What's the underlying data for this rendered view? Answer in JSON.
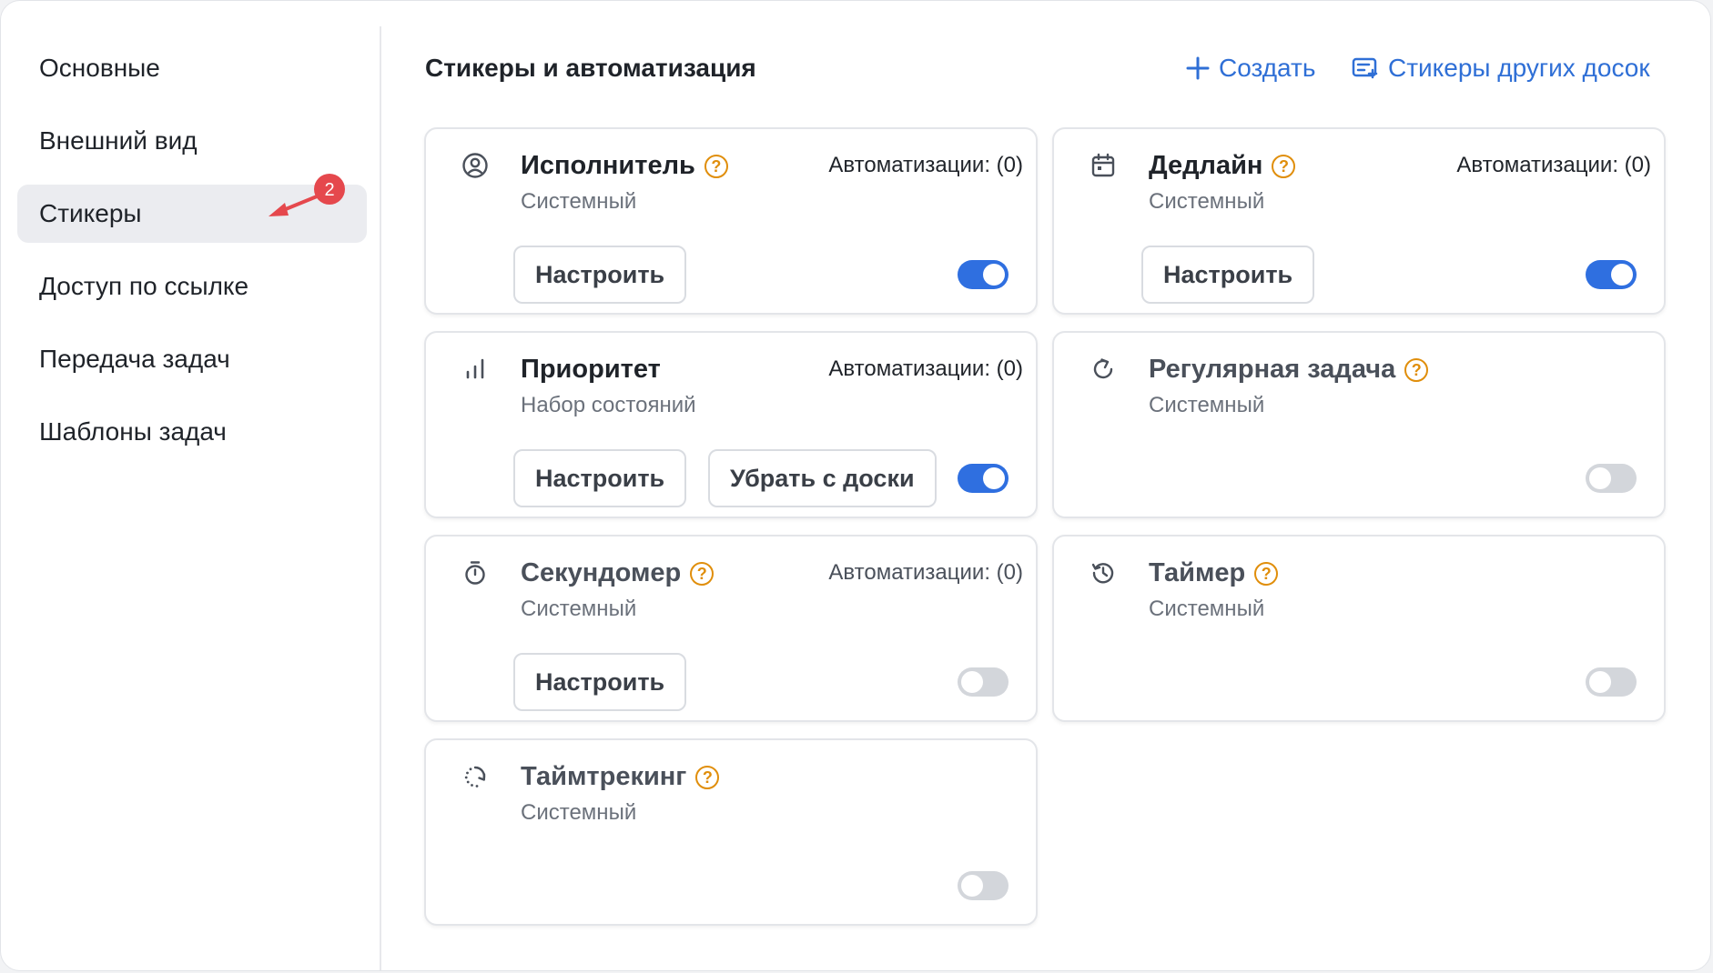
{
  "sidebar": {
    "items": [
      {
        "label": "Основные",
        "active": false
      },
      {
        "label": "Внешний вид",
        "active": false
      },
      {
        "label": "Стикеры",
        "active": true
      },
      {
        "label": "Доступ по ссылке",
        "active": false
      },
      {
        "label": "Передача задач",
        "active": false
      },
      {
        "label": "Шаблоны задач",
        "active": false
      }
    ],
    "annotation_badge": "2"
  },
  "header": {
    "title": "Стикеры и автоматизация",
    "create_label": "Создать",
    "other_boards_label": "Стикеры других досок"
  },
  "help_glyph": "?",
  "cards": [
    {
      "icon": "user-circle-icon",
      "title": "Исполнитель",
      "subtitle": "Системный",
      "automations": "Автоматизации: (0)",
      "configure": "Настроить",
      "enabled": true
    },
    {
      "icon": "calendar-icon",
      "title": "Дедлайн",
      "subtitle": "Системный",
      "automations": "Автоматизации: (0)",
      "configure": "Настроить",
      "enabled": true
    },
    {
      "icon": "bar-chart-icon",
      "title": "Приоритет",
      "subtitle": "Набор состояний",
      "automations": "Автоматизации: (0)",
      "configure": "Настроить",
      "remove": "Убрать с доски",
      "enabled": true
    },
    {
      "icon": "repeat-icon",
      "title": "Регулярная задача",
      "subtitle": "Системный",
      "enabled": false
    },
    {
      "icon": "stopwatch-icon",
      "title": "Секундомер",
      "subtitle": "Системный",
      "automations": "Автоматизации: (0)",
      "configure": "Настроить",
      "enabled": false
    },
    {
      "icon": "history-clock-icon",
      "title": "Таймер",
      "subtitle": "Системный",
      "enabled": false
    },
    {
      "icon": "time-tracking-icon",
      "title": "Таймтрекинг",
      "subtitle": "Системный",
      "enabled": false
    }
  ],
  "colors": {
    "accent": "#2f6fe0",
    "link": "#2f6fd6",
    "help": "#e08e0b",
    "annotation": "#e5484d"
  }
}
